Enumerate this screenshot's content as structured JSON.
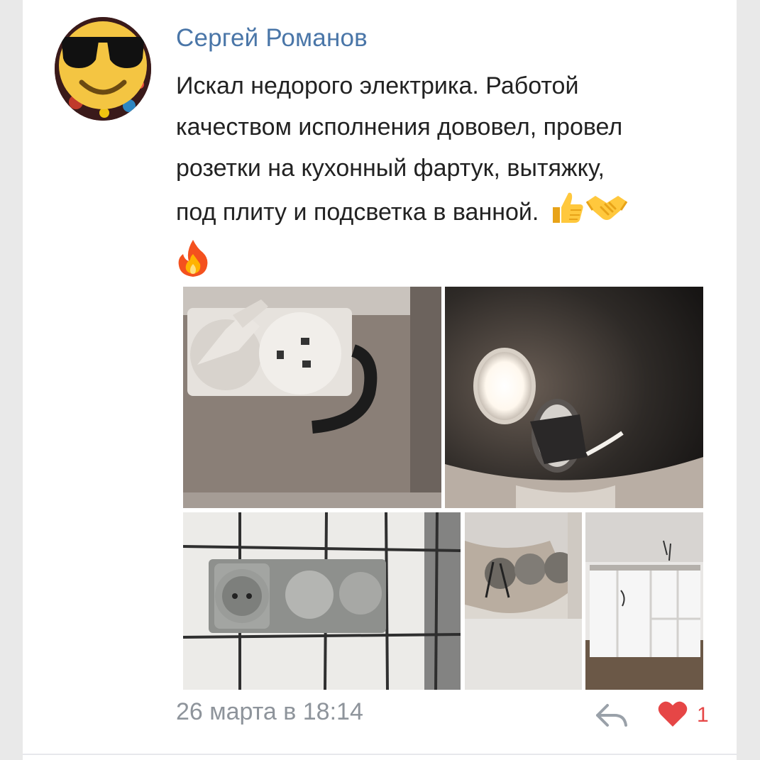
{
  "post": {
    "author": "Сергей Романов",
    "text_lines": [
      "Искал недорого электрика. Работой",
      "качеством исполнения дововел, провел",
      "розетки на кухонный фартук, вытяжку,",
      "под плиту и подсветка в ванной."
    ],
    "emoji": [
      "thumbs-up-icon",
      "handshake-icon",
      "fire-icon"
    ],
    "photos": [
      {
        "name": "photo-outlet-plug"
      },
      {
        "name": "photo-wall-lamp"
      },
      {
        "name": "photo-double-socket"
      },
      {
        "name": "photo-wall-boxes"
      },
      {
        "name": "photo-kitchen-cabinets"
      }
    ],
    "timestamp": "26 марта в 18:14",
    "likes": "1"
  },
  "colors": {
    "author": "#4a76a8",
    "text": "#222222",
    "meta": "#8e949b",
    "like": "#e64646"
  }
}
